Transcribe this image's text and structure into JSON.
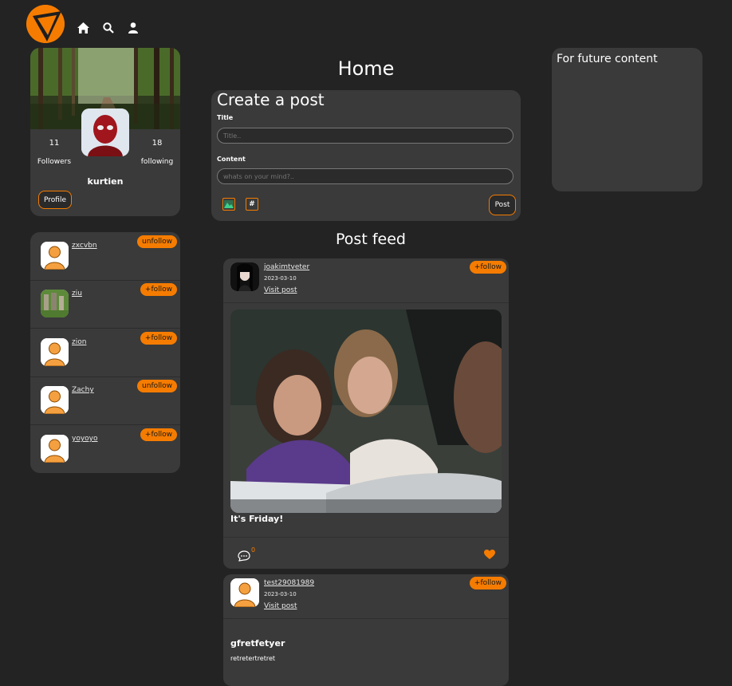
{
  "nav": {
    "icons": [
      "logo-icon",
      "home-icon",
      "search-icon",
      "user-icon"
    ]
  },
  "page_title": "Home",
  "colors": {
    "accent": "#f57c00",
    "card": "#3a3a3a",
    "background": "#232323"
  },
  "profile": {
    "followers_count": "11",
    "followers_label": "Followers",
    "following_count": "18",
    "following_label": "following",
    "username": "kurtien",
    "profile_button": "Profile"
  },
  "follow_list": [
    {
      "name": "zxcvbn",
      "action": "unfollow"
    },
    {
      "name": "ziu",
      "action": "+follow"
    },
    {
      "name": "zion",
      "action": "+follow"
    },
    {
      "name": "Zachy",
      "action": "unfollow"
    },
    {
      "name": "yoyoyo",
      "action": "+follow"
    }
  ],
  "create_post": {
    "heading": "Create a post",
    "title_label": "Title",
    "title_placeholder": "Title..",
    "content_label": "Content",
    "content_placeholder": "whats on your mind?..",
    "hashtag_symbol": "#",
    "post_button": "Post"
  },
  "future": {
    "title": "For future content"
  },
  "feed": {
    "heading": "Post feed",
    "posts": [
      {
        "user": "joakimtveter",
        "date": "2023-03-10",
        "visit": "Visit post",
        "follow": "+follow",
        "title": "It's Friday!",
        "comment_count": "0"
      },
      {
        "user": "test29081989",
        "date": "2023-03-10",
        "visit": "Visit post",
        "follow": "+follow",
        "title": "gfretfetyer",
        "body": "retretertretret"
      }
    ]
  }
}
